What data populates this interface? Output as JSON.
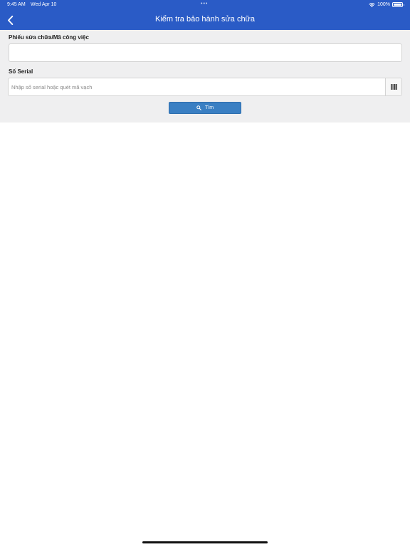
{
  "status_bar": {
    "time": "9:45 AM",
    "date": "Wed Apr 10",
    "dots": "•••",
    "battery": "100%"
  },
  "header": {
    "title": "Kiểm tra bảo hành sửa chữa",
    "back_icon": "chevron-left-icon",
    "background_color": "#2a5bc6"
  },
  "form": {
    "ticket_label": "Phiếu sửa chữa/Mã công việc",
    "ticket_value": "",
    "serial_label": "Số Serial",
    "serial_value": "",
    "serial_placeholder": "Nhập số serial hoặc quét mã vạch",
    "barcode_icon": "barcode-icon",
    "search_button_label": "Tìm",
    "search_icon": "search-icon",
    "accent_color": "#3a7fc3"
  }
}
